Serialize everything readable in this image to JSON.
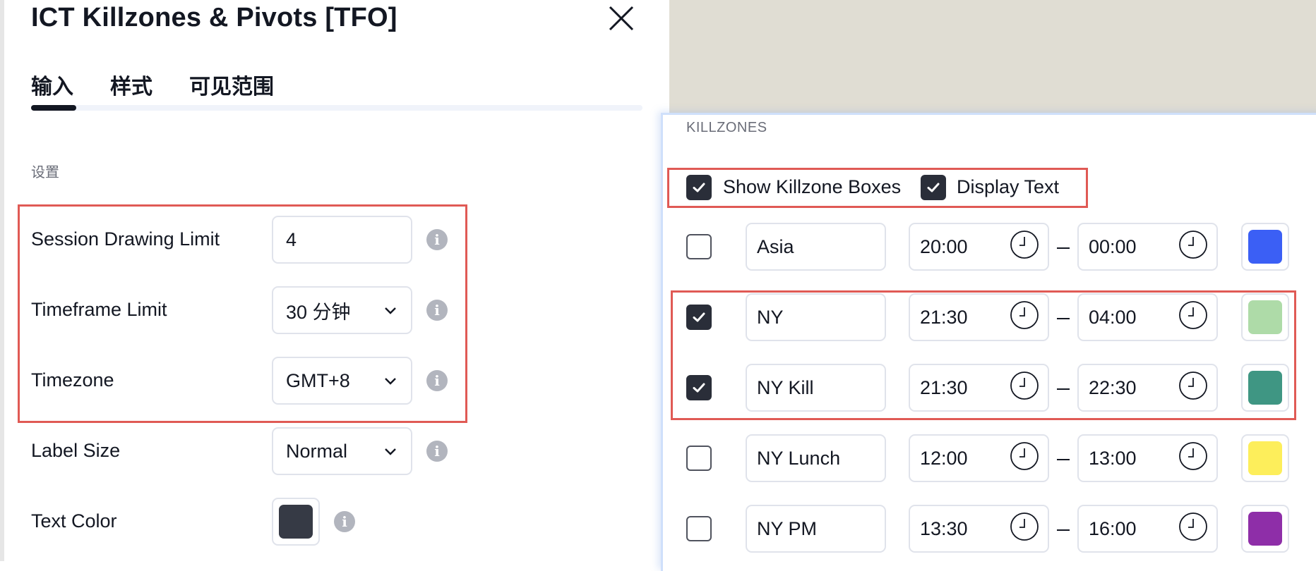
{
  "dialog": {
    "title": "ICT Killzones & Pivots [TFO]",
    "tabs": [
      {
        "label": "输入",
        "active": true
      },
      {
        "label": "样式",
        "active": false
      },
      {
        "label": "可见范围",
        "active": false
      }
    ],
    "section_label": "设置",
    "settings": [
      {
        "label": "Session Drawing Limit",
        "type": "number",
        "value": "4"
      },
      {
        "label": "Timeframe Limit",
        "type": "select",
        "value": "30 分钟"
      },
      {
        "label": "Timezone",
        "type": "select",
        "value": "GMT+8"
      },
      {
        "label": "Label Size",
        "type": "select",
        "value": "Normal"
      },
      {
        "label": "Text Color",
        "type": "color",
        "value": "#363a45"
      }
    ],
    "info_glyph": "i"
  },
  "killzones": {
    "heading": "KILLZONES",
    "show_boxes": {
      "label": "Show Killzone Boxes",
      "checked": true
    },
    "display_text": {
      "label": "Display Text",
      "checked": true
    },
    "rows": [
      {
        "enabled": false,
        "name": "Asia",
        "start": "20:00",
        "end": "00:00",
        "color": "#3b5ff5"
      },
      {
        "enabled": true,
        "name": "NY",
        "start": "21:30",
        "end": "04:00",
        "color": "#aedba8"
      },
      {
        "enabled": true,
        "name": "NY Kill",
        "start": "21:30",
        "end": "22:30",
        "color": "#3f9683"
      },
      {
        "enabled": false,
        "name": "NY Lunch",
        "start": "12:00",
        "end": "13:00",
        "color": "#fdee5b"
      },
      {
        "enabled": false,
        "name": "NY PM",
        "start": "13:30",
        "end": "16:00",
        "color": "#8e2ea8"
      }
    ]
  },
  "colors": {
    "highlight": "#e05a55",
    "checkbox_checked": "#2a2e39",
    "chart_background": "#e0ddd3"
  }
}
